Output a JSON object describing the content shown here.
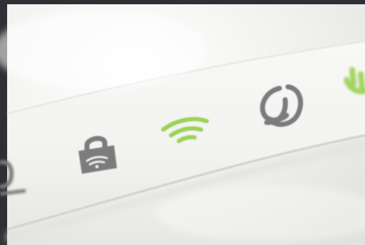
{
  "photo": {
    "colors": {
      "frame": "#2f3033",
      "surface": "#f1f1ef",
      "band": "#f6f6f4",
      "icon_gray": "#7a7a7a",
      "icon_green": "#9fd15a",
      "shadow": "#d9dad7"
    },
    "icons": [
      {
        "name": "device-icon",
        "color": "icon_gray"
      },
      {
        "name": "wifi-lock-icon",
        "color": "icon_gray"
      },
      {
        "name": "wifi-icon",
        "color": "icon_green"
      },
      {
        "name": "internet-icon",
        "color": "icon_gray"
      },
      {
        "name": "power-icon",
        "color": "icon_green"
      }
    ]
  }
}
